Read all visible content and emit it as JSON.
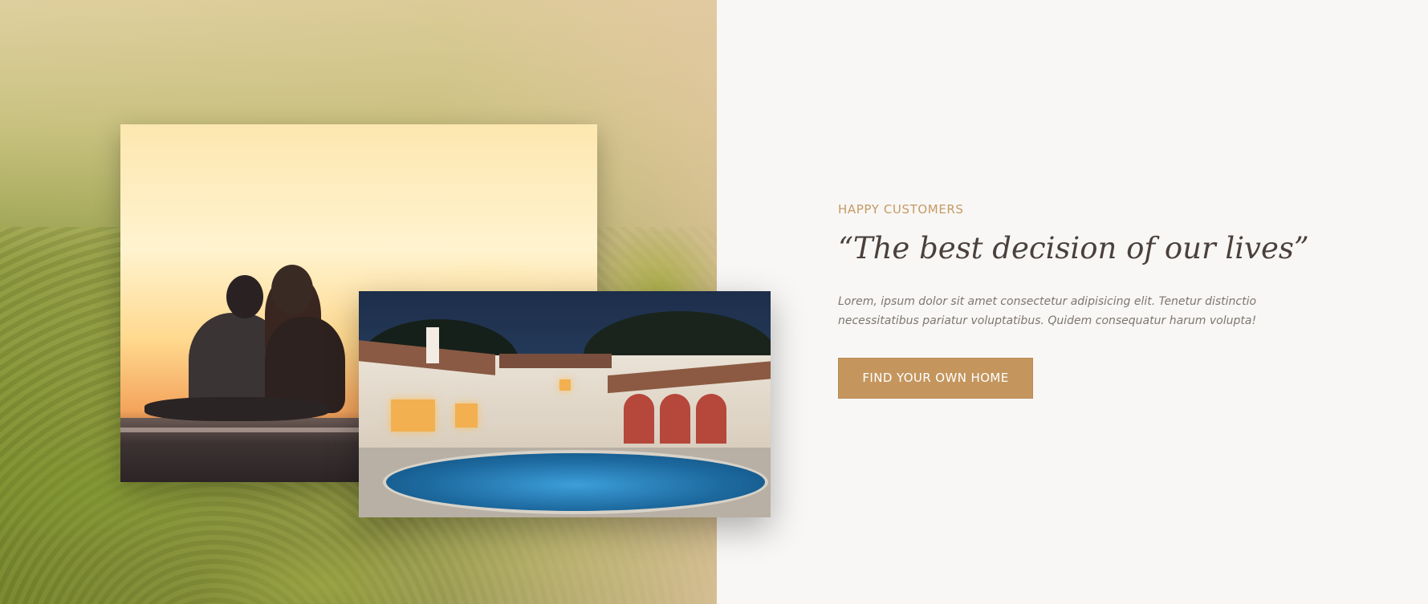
{
  "section": {
    "eyebrow": "HAPPY CUSTOMERS",
    "headline": "“The best decision of our lives”",
    "body": "Lorem, ipsum dolor sit amet consectetur adipisicing elit. Tenetur distinctio necessitatibus pariatur voluptatibus. Quidem consequatur harum volupta!",
    "cta_label": "FIND YOUR OWN HOME"
  },
  "colors": {
    "accent": "#c4965e",
    "eyebrow": "#c59a66",
    "headline": "#4a403c",
    "body": "#7e7670",
    "background": "#f8f7f5"
  }
}
